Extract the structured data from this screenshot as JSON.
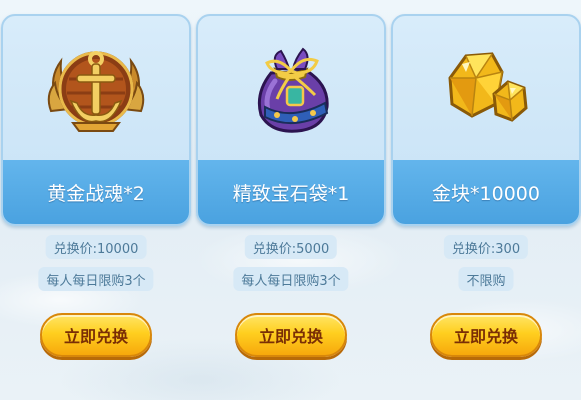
{
  "items": [
    {
      "name": "黄金战魂*2",
      "price": "兑换价:10000",
      "limit": "每人每日限购3个",
      "button": "立即兑换",
      "icon": "golden-anchor-emblem-icon"
    },
    {
      "name": "精致宝石袋*1",
      "price": "兑换价:5000",
      "limit": "每人每日限购3个",
      "button": "立即兑换",
      "icon": "gem-pouch-icon"
    },
    {
      "name": "金块*10000",
      "price": "兑换价:300",
      "limit": "不限购",
      "button": "立即兑换",
      "icon": "gold-nugget-icon"
    }
  ],
  "colors": {
    "name_bar": "#4aa2e0",
    "card_bg": "#c7e2f6",
    "button_gold": "#ffcf1f",
    "button_text": "#7a2e05",
    "pill_bg": "#d7e9f6",
    "pill_text": "#4d7a99"
  }
}
